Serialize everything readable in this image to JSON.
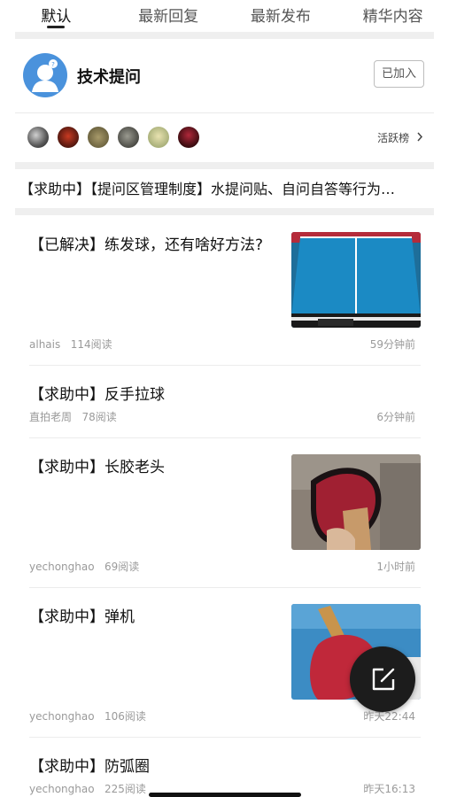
{
  "tabs": [
    {
      "label": "默认",
      "active": true
    },
    {
      "label": "最新回复",
      "active": false
    },
    {
      "label": "最新发布",
      "active": false
    },
    {
      "label": "精华内容",
      "active": false
    }
  ],
  "forum": {
    "title": "技术提问",
    "joined_label": "已加入",
    "ranking_label": "活跃榜",
    "member_count": 6
  },
  "notice": {
    "text": "【求助中】【提问区管理制度】水提问贴、自问自答等行为…"
  },
  "posts": [
    {
      "title": "【已解决】练发球，还有啥好方法?",
      "author": "alhais",
      "reads": "114阅读",
      "time": "59分钟前",
      "thumb": "table-tennis-table"
    },
    {
      "title": "【求助中】反手拉球",
      "author": "直拍老周",
      "reads": "78阅读",
      "time": "6分钟前",
      "thumb": ""
    },
    {
      "title": "【求助中】长胶老头",
      "author": "yechonghao",
      "reads": "69阅读",
      "time": "1小时前",
      "thumb": "paddle-photo"
    },
    {
      "title": "【求助中】弹机",
      "author": "yechonghao",
      "reads": "106阅读",
      "time": "昨天22:44",
      "thumb": "paddle-photo-blue"
    },
    {
      "title": "【求助中】防弧圈",
      "author": "yechonghao",
      "reads": "225阅读",
      "time": "昨天16:13",
      "thumb": ""
    }
  ],
  "colors": {
    "forum_avatar": "#4a92dc",
    "fab": "#1c1c1c",
    "gap": "#efefef"
  },
  "icons": {
    "fab": "edit-icon",
    "ranking": "chevron-right-icon"
  }
}
